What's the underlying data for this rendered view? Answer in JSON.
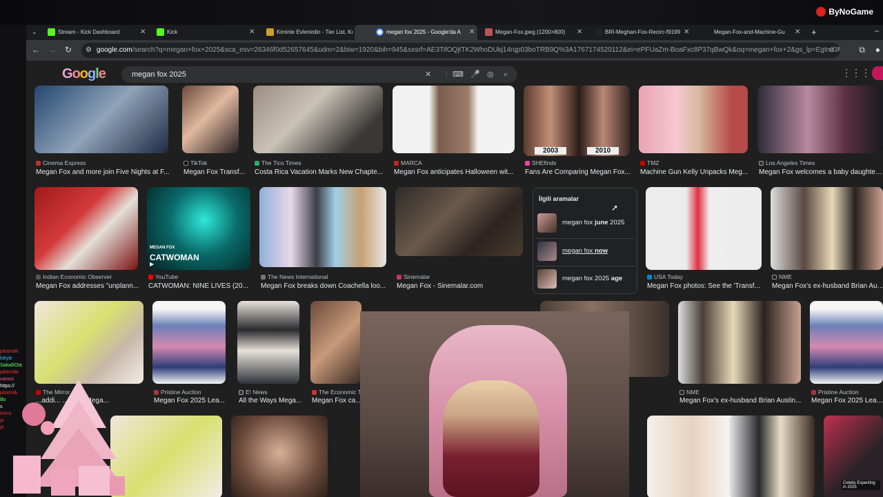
{
  "overlay": {
    "brand": "ByNoGame"
  },
  "tabs": [
    {
      "title": "Stream - Kick Dashboard",
      "favicon": "kick-icon",
      "active": false
    },
    {
      "title": "Kick",
      "favicon": "kick-icon",
      "active": false
    },
    {
      "title": "Kiminle Evlenirdin - Tier List, Kı",
      "favicon": "tierlist-icon",
      "active": false
    },
    {
      "title": "megan fox 2025 - Google'da A",
      "favicon": "google-icon",
      "active": true
    },
    {
      "title": "Megan-Fox.jpeg (1200×800)",
      "favicon": "image-icon",
      "active": false
    },
    {
      "title": "BRI-Meghan-Fox-Recirc-f9199",
      "favicon": "image-icon",
      "active": false
    },
    {
      "title": "Megan-Fox-and-Machine-Gu",
      "favicon": "image-icon",
      "active": false
    }
  ],
  "address": {
    "host": "google.com",
    "path": "/search?q=megan+fox+2025&sca_esv=26346f0d52657645&udm=2&biw=1920&bih=945&sxsrf=AE3TifOQjtTK2WhoDUkj14rqp03boTRB9Q%3A1767174520112&ei=ePFUaZm-BoaFxc8P37qBwQk&oq=megan+fox+2&gs_lp=Egtnd3Mtd2l6LWl..."
  },
  "google": {
    "logo_letters": [
      "G",
      "o",
      "o",
      "g",
      "l",
      "e"
    ],
    "query": "megan fox 2025"
  },
  "results_row1": [
    {
      "source": "Cinema Express",
      "title": "Megan Fox and more join Five Nights at F...",
      "color": "#b33"
    },
    {
      "source": "TikTok",
      "title": "Megan Fox Transf...",
      "color": "#111"
    },
    {
      "source": "The Tico Times",
      "title": "Costa Rica Vacation Marks New Chapte...",
      "color": "#3a6"
    },
    {
      "source": "MARCA",
      "title": "Megan Fox anticipates Halloween wit...",
      "color": "#c22"
    },
    {
      "source": "SHEfinds",
      "title": "Fans Are Comparing Megan Fox...",
      "color": "#e4a",
      "years": [
        "2003",
        "2010"
      ]
    },
    {
      "source": "TMZ",
      "title": "Machine Gun Kelly Unpacks Meg...",
      "color": "#c00"
    },
    {
      "source": "Los Angeles Times",
      "title": "Megan Fox welcomes a baby daughter wi...",
      "color": "#333"
    }
  ],
  "results_row2": [
    {
      "source": "Indian Economic Observer",
      "title": "Megan Fox addresses \"unplann...",
      "color": "#555"
    },
    {
      "source": "YouTube",
      "title": "CATWOMAN: NINE LIVES (20...",
      "color": "#f00",
      "overlay": "CATWOMAN",
      "overlay_top": "MEGAN FOX"
    },
    {
      "source": "The News International",
      "title": "Megan Fox breaks down Coachella loo...",
      "color": "#777"
    },
    {
      "source": "Sinemalar",
      "title": "Megan Fox - Sinemalar.com",
      "color": "#c36"
    },
    {
      "source": "USA Today",
      "title": "Megan Fox photos: See the 'Transf...",
      "color": "#08c"
    },
    {
      "source": "NME",
      "title": "Megan Fox's ex-husband Brian Austi...",
      "color": "#222"
    }
  ],
  "results_row3": [
    {
      "source": "The Mirror",
      "title": "...addi... ...bling' Mega...",
      "color": "#c00"
    },
    {
      "source": "Pristine Auction",
      "title": "Megan Fox 2025 Lea...",
      "color": "#a34"
    },
    {
      "source": "E! News",
      "title": "All the Ways Mega...",
      "color": "#333"
    },
    {
      "source": "The Economic T",
      "title": "Megan Fox cast...",
      "color": "#c33"
    },
    {
      "source": "NME",
      "title": "Megan Fox's ex-husband Brian Austin...",
      "color": "#222"
    },
    {
      "source": "Pristine Auction",
      "title": "Megan Fox 2025 Leaf ...",
      "color": "#a34"
    }
  ],
  "related": {
    "heading": "İlgili aramalar",
    "items": [
      {
        "prefix": "megan fox ",
        "bold": "june",
        "suffix": " 2025"
      },
      {
        "prefix": "megan fox ",
        "bold": "now",
        "suffix": ""
      },
      {
        "prefix": "megan fox 2025 ",
        "bold": "age",
        "suffix": ""
      }
    ]
  },
  "thumb_overlay": {
    "text": "Celebs Expecting in 2025"
  },
  "chat": {
    "lines": [
      "pilotmilik",
      "kittyle",
      "SakalliOta",
      "pilotmilik",
      "vanxsi",
      "https://",
      "pilotmilk",
      "lllo",
      "s",
      "ilotmi",
      "pi",
      "pi"
    ]
  }
}
